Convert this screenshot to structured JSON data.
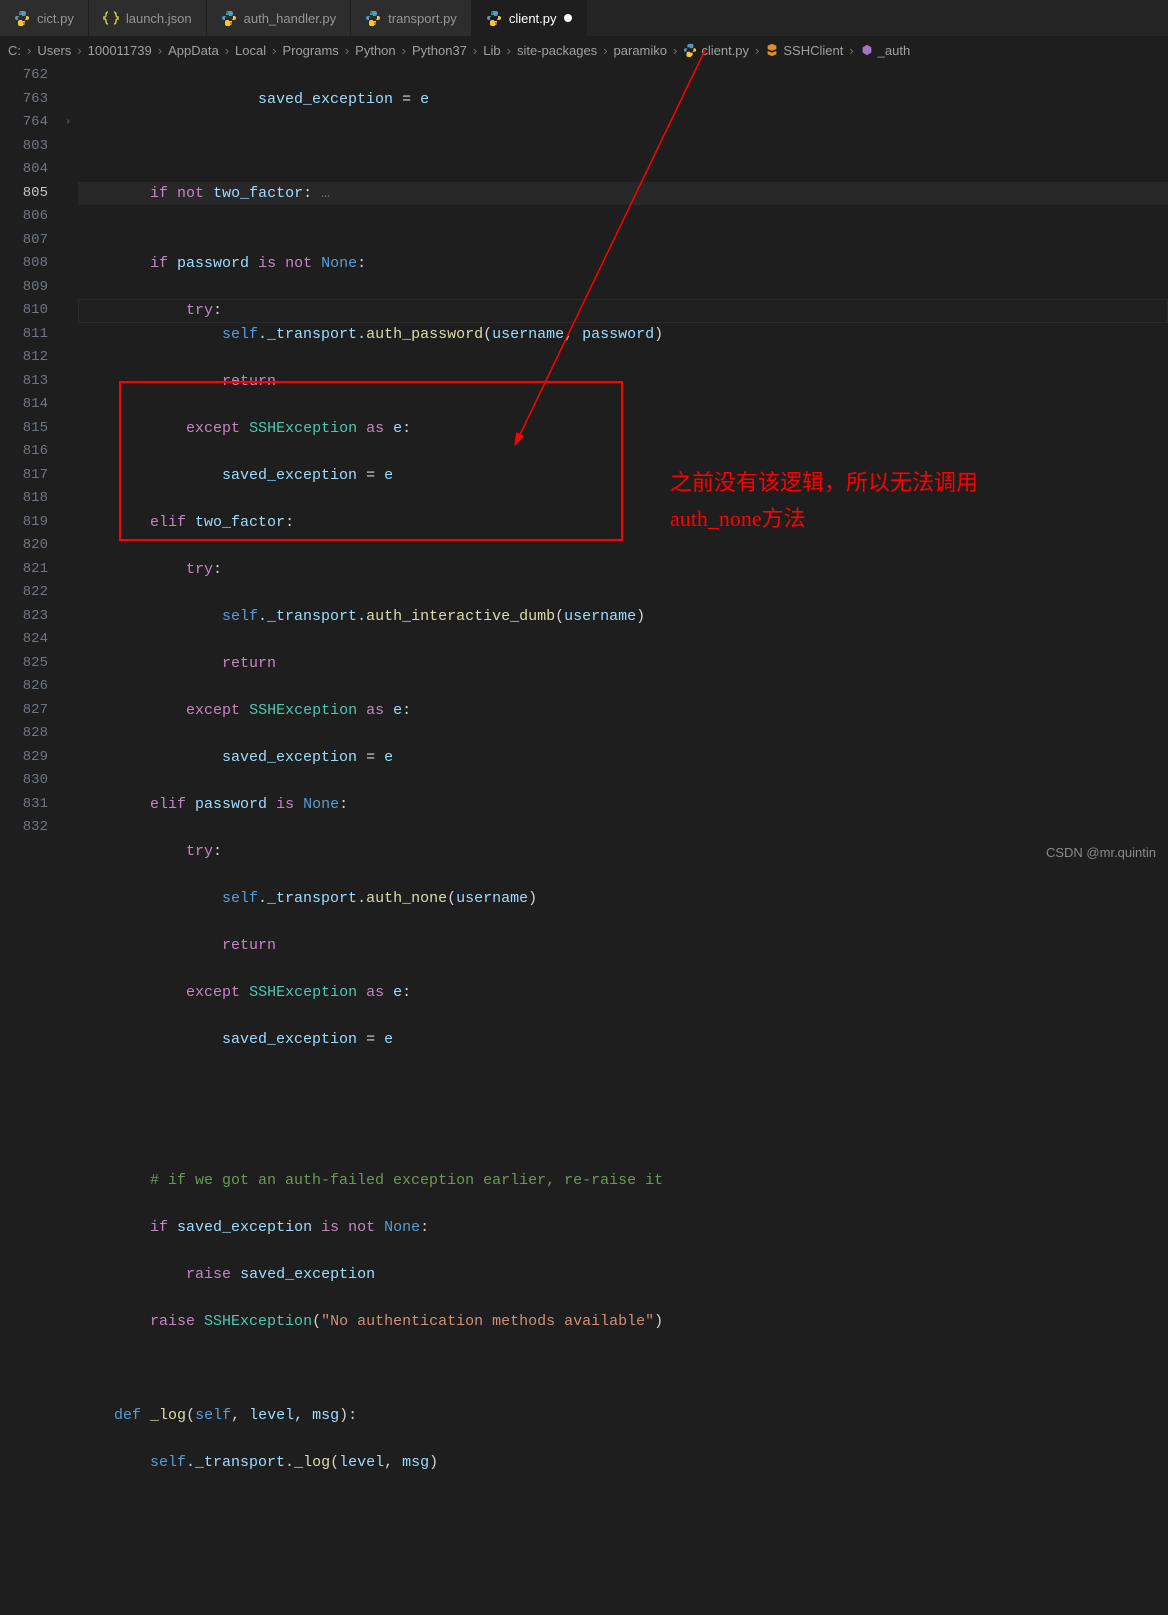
{
  "tabs": [
    {
      "label": "cict.py",
      "type": "python",
      "active": false
    },
    {
      "label": "launch.json",
      "type": "json",
      "active": false
    },
    {
      "label": "auth_handler.py",
      "type": "python",
      "active": false
    },
    {
      "label": "transport.py",
      "type": "python",
      "active": false
    },
    {
      "label": "client.py",
      "type": "python",
      "active": true,
      "dirty": true
    }
  ],
  "breadcrumb": {
    "items": [
      "C:",
      "Users",
      "100011739",
      "AppData",
      "Local",
      "Programs",
      "Python",
      "Python37",
      "Lib",
      "site-packages",
      "paramiko"
    ],
    "file": "client.py",
    "class": "SSHClient",
    "method": "_auth"
  },
  "lines": {
    "nums": [
      "762",
      "763",
      "764",
      "803",
      "804",
      "805",
      "806",
      "807",
      "808",
      "809",
      "810",
      "811",
      "812",
      "813",
      "814",
      "815",
      "816",
      "817",
      "818",
      "819",
      "820",
      "821",
      "822",
      "823",
      "824",
      "825",
      "826",
      "827",
      "828",
      "829",
      "830",
      "831",
      "832"
    ],
    "active_line": "805"
  },
  "code": {
    "l762": "                    saved_exception = e",
    "l764_1": "        ",
    "l764_if": "if",
    "l764_not": "not",
    "l764_var": "two_factor",
    "l764_c": ":",
    "l804_if": "if",
    "l804_v": "password",
    "l804_is": "is",
    "l804_not": "not",
    "l804_none": "None",
    "l804_c": ":",
    "l805_try": "try",
    "l805_c": ":",
    "l806_s": "self",
    "l806_t": "._transport.",
    "l806_fn": "auth_password",
    "l806_p1": "(",
    "l806_a1": "username",
    "l806_com": ", ",
    "l806_a2": "password",
    "l806_p2": ")",
    "l807_r": "return",
    "l808_ex": "except",
    "l808_cls": "SSHException",
    "l808_as": "as",
    "l808_e": "e",
    "l808_c": ":",
    "l809": "                saved_exception = e",
    "l810_el": "elif",
    "l810_v": "two_factor",
    "l810_c": ":",
    "l811_try": "try",
    "l811_c": ":",
    "l812_s": "self",
    "l812_t": "._transport.",
    "l812_fn": "auth_interactive_dumb",
    "l812_p1": "(",
    "l812_a1": "username",
    "l812_p2": ")",
    "l813_r": "return",
    "l814_ex": "except",
    "l814_cls": "SSHException",
    "l814_as": "as",
    "l814_e": "e",
    "l814_c": ":",
    "l815": "                saved_exception = e",
    "l816_el": "elif",
    "l816_v": "password",
    "l816_is": "is",
    "l816_none": "None",
    "l816_c": ":",
    "l817_try": "try",
    "l817_c": ":",
    "l818_s": "self",
    "l818_t": "._transport.",
    "l818_fn": "auth_none",
    "l818_p1": "(",
    "l818_a1": "username",
    "l818_p2": ")",
    "l819_r": "return",
    "l820_ex": "except",
    "l820_cls": "SSHException",
    "l820_as": "as",
    "l820_e": "e",
    "l820_c": ":",
    "l821": "                saved_exception = e",
    "l824_cmt": "# if we got an auth-failed exception earlier, re-raise it",
    "l825_if": "if",
    "l825_v": "saved_exception",
    "l825_is": "is",
    "l825_not": "not",
    "l825_none": "None",
    "l825_c": ":",
    "l826_r": "raise",
    "l826_v": "saved_exception",
    "l827_r": "raise",
    "l827_cls": "SSHException",
    "l827_p1": "(",
    "l827_str": "\"No authentication methods available\"",
    "l827_p2": ")",
    "l829_def": "def",
    "l829_fn": "_log",
    "l829_p1": "(",
    "l829_s": "self",
    "l829_c1": ", ",
    "l829_a1": "level",
    "l829_c2": ", ",
    "l829_a2": "msg",
    "l829_p2": "):",
    "l830_s": "self",
    "l830_t": "._transport.",
    "l830_fn": "_log",
    "l830_p1": "(",
    "l830_a1": "level",
    "l830_c": ", ",
    "l830_a2": "msg",
    "l830_p2": ")"
  },
  "annotation": {
    "line1": "之前没有该逻辑，所以无法调用",
    "line2": "auth_none方法"
  },
  "watermark": "CSDN @mr.quintin"
}
